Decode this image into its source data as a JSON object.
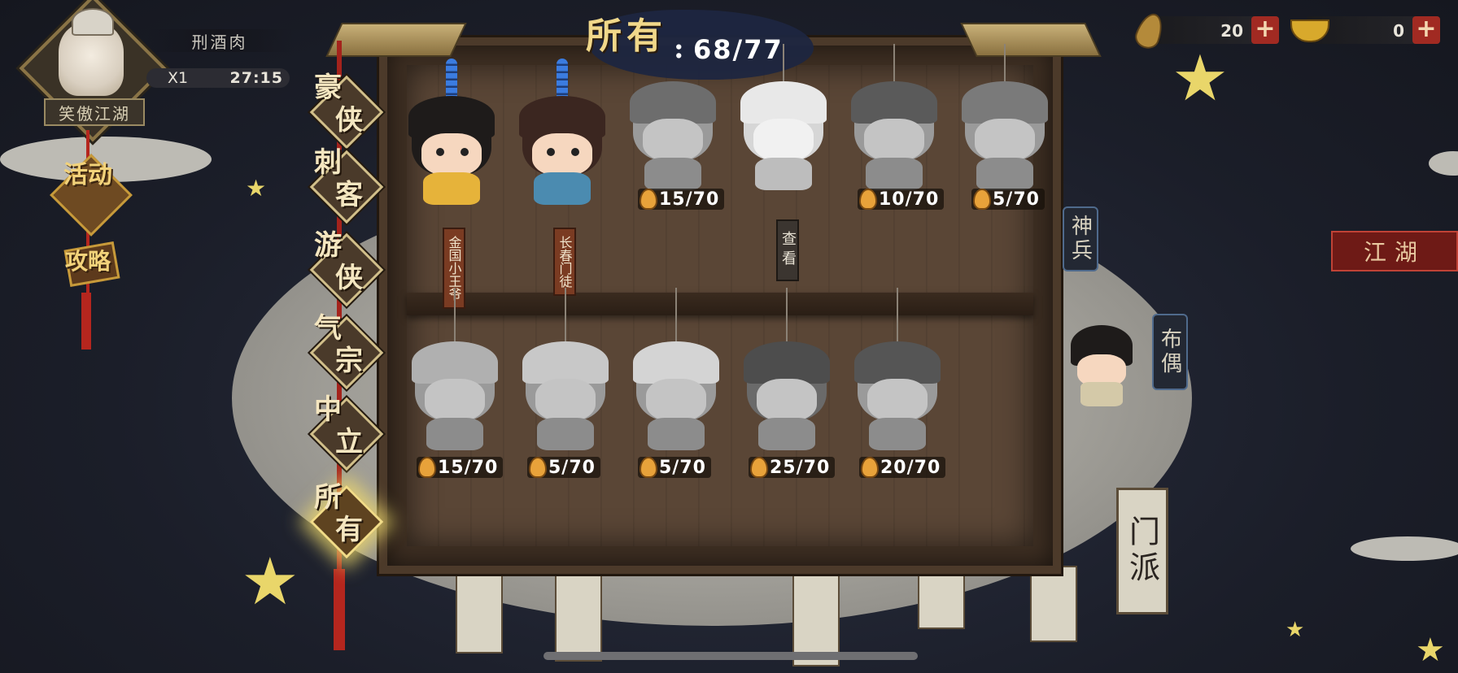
{
  "header": {
    "title": "所有",
    "colon": ":",
    "count": "68/77"
  },
  "player": {
    "name": "刑酒肉",
    "title": "笑傲江湖",
    "stamina_multiplier": "X1",
    "stamina_timer": "27:15"
  },
  "side_menu": [
    {
      "label": "活动",
      "icon": "event-knot-icon"
    },
    {
      "label": "攻略",
      "icon": "guide-scroll-icon"
    }
  ],
  "currency": {
    "leaf": {
      "value": "20",
      "icon": "leaf-icon"
    },
    "ingot": {
      "value": "0",
      "icon": "gold-ingot-icon"
    }
  },
  "categories": [
    {
      "label": "豪侠",
      "active": false
    },
    {
      "label": "刺客",
      "active": false
    },
    {
      "label": "游侠",
      "active": false
    },
    {
      "label": "气宗",
      "active": false
    },
    {
      "label": "中立",
      "active": false
    },
    {
      "label": "所有",
      "active": true
    }
  ],
  "puppets_row1": [
    {
      "name": "金国小王爷",
      "progress": null,
      "colored": true
    },
    {
      "name": "长春门徒",
      "progress": null,
      "colored": true
    },
    {
      "name": null,
      "progress": "15/70",
      "colored": false
    },
    {
      "name": null,
      "progress": null,
      "colored": false,
      "action": "查看"
    },
    {
      "name": null,
      "progress": "10/70",
      "colored": false
    },
    {
      "name": null,
      "progress": "5/70",
      "colored": false
    }
  ],
  "puppets_row2": [
    {
      "progress": "15/70"
    },
    {
      "progress": "5/70"
    },
    {
      "progress": "5/70"
    },
    {
      "progress": "25/70"
    },
    {
      "progress": "20/70"
    }
  ],
  "right_panel": {
    "jianghu_button": "江湖",
    "shenbing_label": "神兵",
    "buou_label": "布偶",
    "menpai_tag": "门派"
  },
  "colors": {
    "accent_gold": "#f1d88a",
    "plus_red": "#a12a22",
    "cabinet_wood": "#4c3a2a"
  }
}
